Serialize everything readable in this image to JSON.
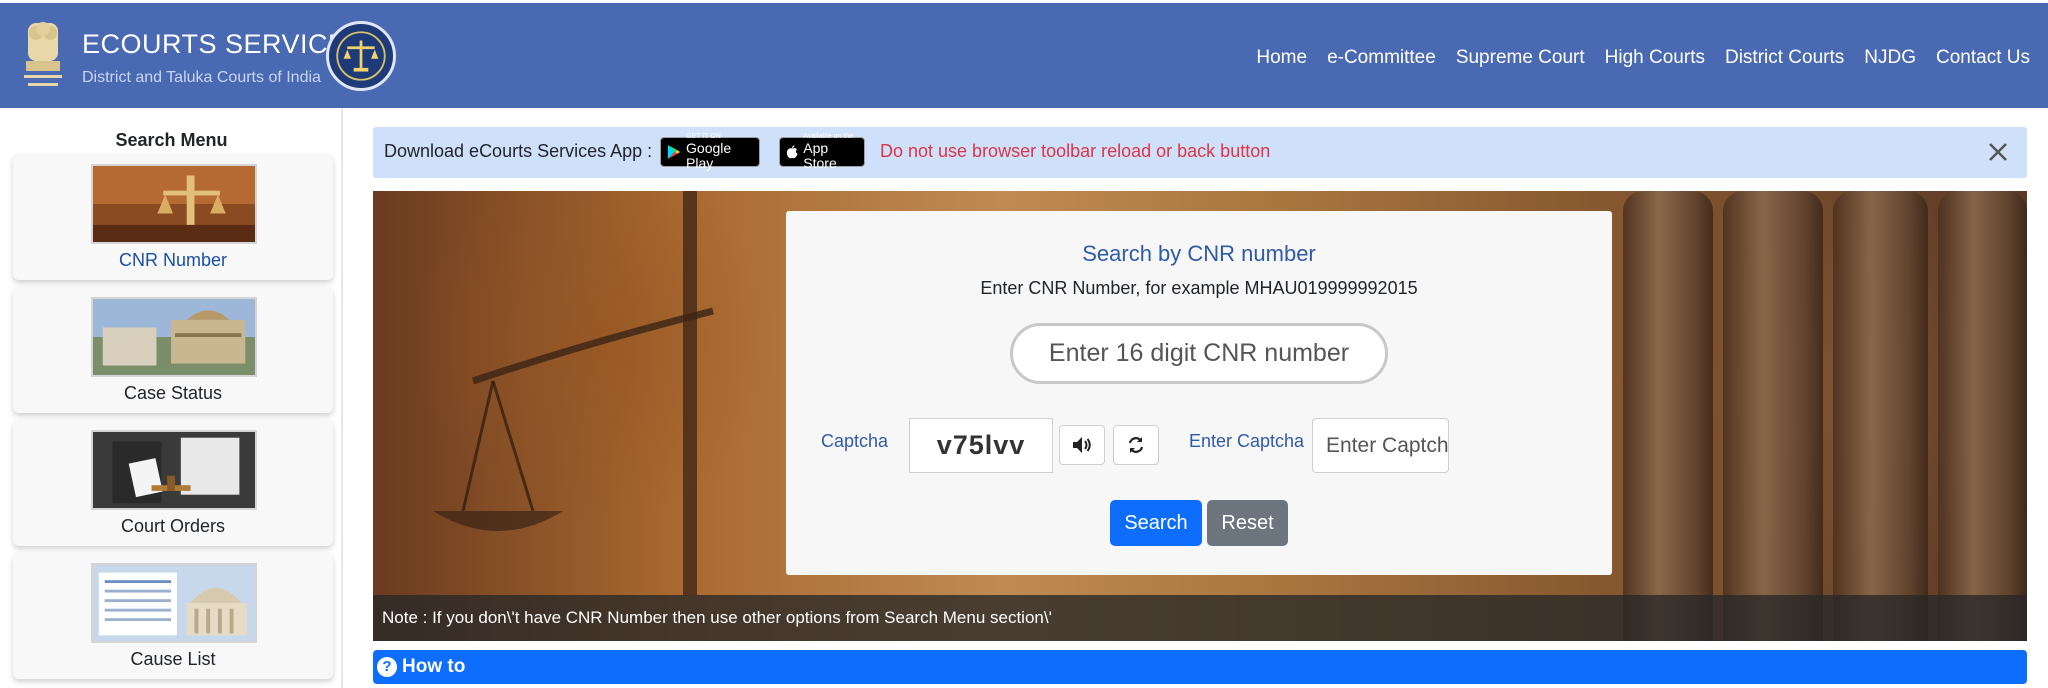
{
  "header": {
    "title": "ECOURTS SERVICES",
    "subtitle": "District and Taluka Courts of India",
    "nav": [
      "Home",
      "e-Committee",
      "Supreme Court",
      "High Courts",
      "District Courts",
      "NJDG",
      "Contact Us"
    ]
  },
  "sidebar": {
    "title": "Search Menu",
    "items": [
      {
        "label": "CNR Number",
        "active": true
      },
      {
        "label": "Case Status",
        "active": false
      },
      {
        "label": "Court Orders",
        "active": false
      },
      {
        "label": "Cause List",
        "active": false
      }
    ]
  },
  "alert": {
    "download_text": "Download eCourts Services App :",
    "google_play": {
      "small": "GET IT ON",
      "big": "Google Play"
    },
    "app_store": {
      "small": "Available on the",
      "big": "App Store"
    },
    "warning": "Do not use browser toolbar reload or back button"
  },
  "search": {
    "title": "Search by CNR number",
    "hint": "Enter CNR Number, for example MHAU019999992015",
    "cnr_placeholder": "Enter 16 digit CNR number",
    "captcha_label": "Captcha",
    "captcha_value": "v75lvv",
    "enter_captcha_label": "Enter Captcha",
    "captcha_placeholder": "Enter Captcha",
    "search_button": "Search",
    "reset_button": "Reset"
  },
  "note": "Note : If you don\\'t have CNR Number then use other options from Search Menu section\\'",
  "howto": {
    "icon": "?",
    "label": "How to"
  },
  "colors": {
    "header_bg": "#4a69b3",
    "alert_bg": "#cfe0fb",
    "warning": "#dc3545",
    "primary": "#0d6efd",
    "secondary": "#6c757d",
    "title_blue": "#2f5aa8"
  }
}
